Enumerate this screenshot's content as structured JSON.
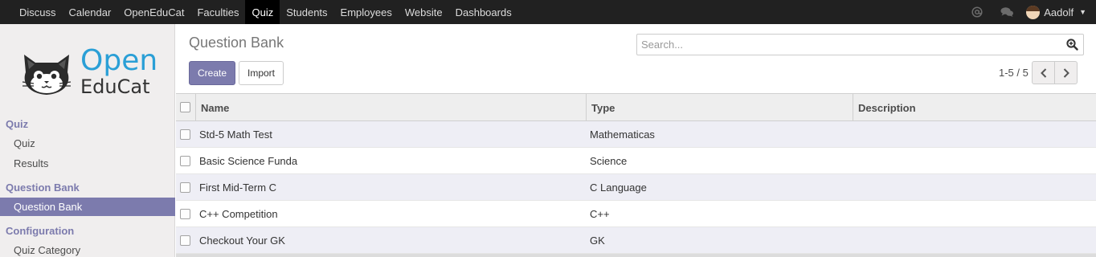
{
  "topbar": {
    "menu": [
      {
        "label": "Discuss",
        "active": false
      },
      {
        "label": "Calendar",
        "active": false
      },
      {
        "label": "OpenEduCat",
        "active": false
      },
      {
        "label": "Faculties",
        "active": false
      },
      {
        "label": "Quiz",
        "active": true
      },
      {
        "label": "Students",
        "active": false
      },
      {
        "label": "Employees",
        "active": false
      },
      {
        "label": "Website",
        "active": false
      },
      {
        "label": "Dashboards",
        "active": false
      }
    ],
    "icons": [
      "at-icon",
      "chat-icon"
    ],
    "user_name": "Aadolf"
  },
  "logo": {
    "line1": "Open",
    "line2": "EduCat"
  },
  "sidebar": {
    "sections": [
      {
        "title": "Quiz",
        "items": [
          {
            "label": "Quiz",
            "active": false
          },
          {
            "label": "Results",
            "active": false
          }
        ]
      },
      {
        "title": "Question Bank",
        "items": [
          {
            "label": "Question Bank",
            "active": true
          }
        ]
      },
      {
        "title": "Configuration",
        "items": [
          {
            "label": "Quiz Category",
            "active": false
          }
        ]
      }
    ]
  },
  "control_panel": {
    "breadcrumb": "Question Bank",
    "create_label": "Create",
    "import_label": "Import",
    "search_placeholder": "Search...",
    "pager": "1-5 / 5"
  },
  "table": {
    "columns": [
      "Name",
      "Type",
      "Description"
    ],
    "rows": [
      {
        "name": "Std-5 Math Test",
        "type": "Mathematicas",
        "description": ""
      },
      {
        "name": "Basic Science Funda",
        "type": "Science",
        "description": ""
      },
      {
        "name": "First Mid-Term C",
        "type": "C Language",
        "description": ""
      },
      {
        "name": "C++ Competition",
        "type": "C++",
        "description": ""
      },
      {
        "name": "Checkout Your GK",
        "type": "GK",
        "description": ""
      }
    ]
  },
  "colors": {
    "accent": "#7c7bad",
    "topbar": "#212121",
    "logo_blue": "#2a9fd6"
  }
}
